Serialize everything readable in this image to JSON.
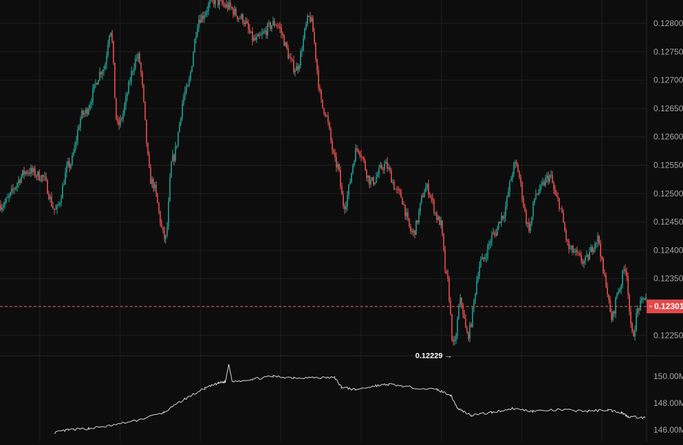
{
  "colors": {
    "background": "#0d0d0d",
    "grid": "#1f1f1f",
    "up": "#26a69a",
    "down": "#ef5350",
    "axis_text": "#a6a6a6",
    "price_line": "#ef5350",
    "price_badge": "#e04a4a",
    "indicator_line": "#d9d9d9",
    "annotation_text": "#ffffff"
  },
  "chart_data": [
    {
      "type": "candlestick",
      "title": "",
      "y_axis": {
        "range": [
          0.12215,
          0.12838
        ],
        "tick_labels": [
          "0.12800",
          "0.12750",
          "0.12700",
          "0.12650",
          "0.12600",
          "0.12550",
          "0.12500",
          "0.12450",
          "0.12400",
          "0.12350",
          "0.12250"
        ],
        "ticks": [
          0.128,
          0.1275,
          0.127,
          0.1265,
          0.126,
          0.1255,
          0.125,
          0.1245,
          0.124,
          0.1235,
          0.1225
        ]
      },
      "current_price": {
        "value": 0.12301,
        "label": "0.12301"
      },
      "low_annotation": {
        "value": 0.12229,
        "label": "0.12229 →",
        "index": 66
      },
      "grid": true,
      "anchors": [
        [
          0,
          0.1248
        ],
        [
          4,
          0.1254
        ],
        [
          6,
          0.1253
        ],
        [
          8,
          0.1247
        ],
        [
          10,
          0.1255
        ],
        [
          12,
          0.1264
        ],
        [
          15,
          0.1272
        ],
        [
          16,
          0.1279
        ],
        [
          17,
          0.1262
        ],
        [
          20,
          0.1274
        ],
        [
          22,
          0.1252
        ],
        [
          24,
          0.1242
        ],
        [
          25,
          0.1256
        ],
        [
          27,
          0.1268
        ],
        [
          29,
          0.1281
        ],
        [
          31,
          0.1284
        ],
        [
          33,
          0.1283
        ],
        [
          35,
          0.1281
        ],
        [
          37,
          0.1277
        ],
        [
          40,
          0.128
        ],
        [
          43,
          0.1272
        ],
        [
          45,
          0.1281
        ],
        [
          47,
          0.1265
        ],
        [
          49,
          0.1255
        ],
        [
          50,
          0.1248
        ],
        [
          52,
          0.1258
        ],
        [
          54,
          0.1252
        ],
        [
          56,
          0.1255
        ],
        [
          58,
          0.125
        ],
        [
          60,
          0.1243
        ],
        [
          62,
          0.1251
        ],
        [
          64,
          0.1245
        ],
        [
          65,
          0.1235
        ],
        [
          66,
          0.1223
        ],
        [
          67,
          0.1231
        ],
        [
          68,
          0.1225
        ],
        [
          70,
          0.1238
        ],
        [
          72,
          0.1243
        ],
        [
          73,
          0.1246
        ],
        [
          75,
          0.1255
        ],
        [
          77,
          0.1244
        ],
        [
          78,
          0.125
        ],
        [
          80,
          0.1253
        ],
        [
          81,
          0.1249
        ],
        [
          83,
          0.124
        ],
        [
          85,
          0.1238
        ],
        [
          87,
          0.1242
        ],
        [
          88,
          0.1235
        ],
        [
          89,
          0.1228
        ],
        [
          90,
          0.1233
        ],
        [
          91,
          0.1237
        ],
        [
          92,
          0.1225
        ],
        [
          93,
          0.123
        ],
        [
          94,
          0.1232
        ]
      ],
      "candles_count": 95
    },
    {
      "type": "line",
      "title": "",
      "y_axis": {
        "range": [
          145.9,
          151.0
        ],
        "tick_labels": [
          "150.00M",
          "148.00M",
          "146.00M"
        ],
        "ticks": [
          150.0,
          148.0,
          146.0
        ]
      },
      "series": [
        {
          "values": [
            [
              0.08,
              145.8
            ],
            [
              0.1,
              146.0
            ],
            [
              0.13,
              146.1
            ],
            [
              0.16,
              146.3
            ],
            [
              0.2,
              146.7
            ],
            [
              0.24,
              147.3
            ],
            [
              0.27,
              148.3
            ],
            [
              0.3,
              149.1
            ],
            [
              0.32,
              149.5
            ],
            [
              0.33,
              149.6
            ],
            [
              0.335,
              150.9
            ],
            [
              0.34,
              149.6
            ],
            [
              0.37,
              149.8
            ],
            [
              0.4,
              150.0
            ],
            [
              0.43,
              149.9
            ],
            [
              0.46,
              149.9
            ],
            [
              0.49,
              149.9
            ],
            [
              0.5,
              149.2
            ],
            [
              0.52,
              149.0
            ],
            [
              0.55,
              149.3
            ],
            [
              0.57,
              149.4
            ],
            [
              0.6,
              149.2
            ],
            [
              0.64,
              149.0
            ],
            [
              0.66,
              148.6
            ],
            [
              0.67,
              147.6
            ],
            [
              0.69,
              147.1
            ],
            [
              0.72,
              147.3
            ],
            [
              0.75,
              147.6
            ],
            [
              0.78,
              147.4
            ],
            [
              0.82,
              147.5
            ],
            [
              0.86,
              147.4
            ],
            [
              0.89,
              147.5
            ],
            [
              0.91,
              147.3
            ],
            [
              0.92,
              147.0
            ],
            [
              0.945,
              146.9
            ]
          ]
        }
      ]
    }
  ]
}
